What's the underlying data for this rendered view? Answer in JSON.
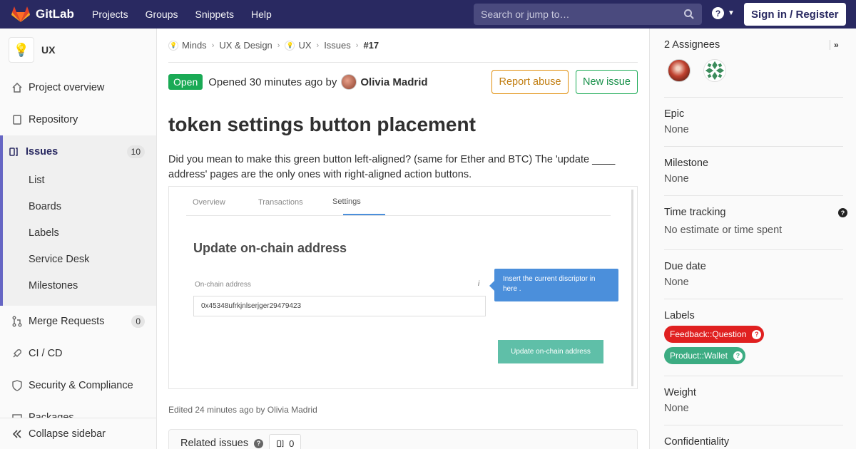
{
  "navbar": {
    "brand": "GitLab",
    "links": [
      "Projects",
      "Groups",
      "Snippets",
      "Help"
    ],
    "search_placeholder": "Search or jump to…",
    "help_glyph": "?",
    "signin_label": "Sign in / Register"
  },
  "sidebar": {
    "project_name": "UX",
    "project_icon": "lightbulb",
    "items": {
      "overview": "Project overview",
      "repository": "Repository",
      "issues": "Issues",
      "issues_count": "10",
      "merge_requests": "Merge Requests",
      "mr_count": "0",
      "cicd": "CI / CD",
      "security": "Security & Compliance",
      "packages": "Packages"
    },
    "issue_subitems": [
      "List",
      "Boards",
      "Labels",
      "Service Desk",
      "Milestones"
    ],
    "collapse_label": "Collapse sidebar"
  },
  "breadcrumb": {
    "group": "Minds",
    "subgroup": "UX & Design",
    "project": "UX",
    "section": "Issues",
    "current": "#17"
  },
  "issue": {
    "status": "Open",
    "opened_text": "Opened 30 minutes ago by",
    "author": "Olivia Madrid",
    "report_label": "Report abuse",
    "new_issue_label": "New issue",
    "title": "token settings button placement",
    "description": "Did you mean to make this green button left-aligned? (same for Ether and BTC) The 'update ____ address' pages are the only ones with right-aligned action buttons.",
    "edited": "Edited 24 minutes ago by Olivia Madrid"
  },
  "embed": {
    "tabs": [
      "Overview",
      "Transactions",
      "Settings"
    ],
    "heading": "Update on-chain address",
    "field_label": "On-chain address",
    "info_glyph": "i",
    "field_value": "0x45348ufrkjnlserjger29479423",
    "tooltip": "Insert the current discriptor in here .",
    "button": "Update on-chain address"
  },
  "related": {
    "title": "Related issues",
    "count": "0"
  },
  "right_sidebar": {
    "assignees": "2 Assignees",
    "collapse_glyph": "»",
    "epic_title": "Epic",
    "epic_value": "None",
    "milestone_title": "Milestone",
    "milestone_value": "None",
    "time_title": "Time tracking",
    "time_value": "No estimate or time spent",
    "due_title": "Due date",
    "due_value": "None",
    "labels_title": "Labels",
    "labels": [
      {
        "text": "Feedback::Question",
        "color": "#e02020"
      },
      {
        "text": "Product::Wallet",
        "color": "#3cac82"
      }
    ],
    "weight_title": "Weight",
    "weight_value": "None",
    "confidentiality_title": "Confidentiality"
  },
  "colors": {
    "navbar": "#292961",
    "open_status": "#1aaa55",
    "report": "#e08e0b",
    "sidebar_accent": "#6666c4"
  }
}
